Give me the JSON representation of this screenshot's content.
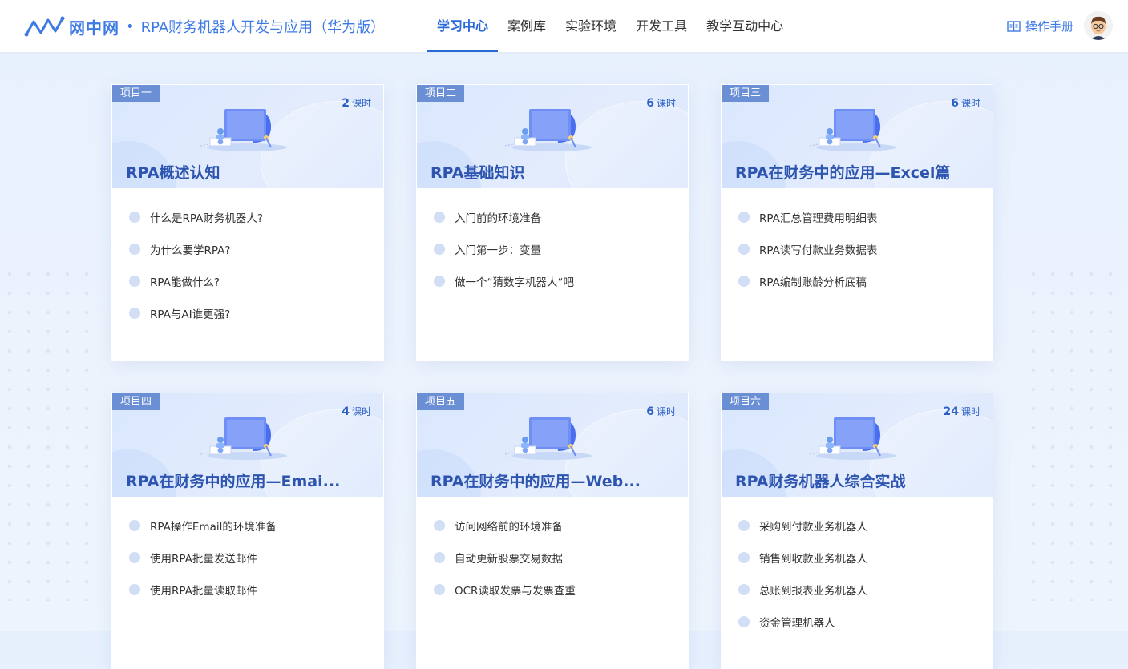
{
  "header": {
    "logo_text": "网中网",
    "separator": "•",
    "course_title": "RPA财务机器人开发与应用（华为版）",
    "nav": [
      {
        "label": "学习中心",
        "active": true
      },
      {
        "label": "案例库",
        "active": false
      },
      {
        "label": "实验环境",
        "active": false
      },
      {
        "label": "开发工具",
        "active": false
      },
      {
        "label": "教学互动中心",
        "active": false
      }
    ],
    "manual_label": "操作手册",
    "manual_icon": "book-icon",
    "avatar_icon": "user-avatar"
  },
  "colors": {
    "accent": "#2a6ad8",
    "brand": "#3d7ae5",
    "tag": "#6a8fd4",
    "title": "#2d55b0"
  },
  "hours_unit": "课时",
  "cards": [
    {
      "tag": "项目一",
      "hours": "2",
      "title": "RPA概述认知",
      "items": [
        "什么是RPA财务机器人?",
        "为什么要学RPA?",
        "RPA能做什么?",
        "RPA与AI谁更强?"
      ]
    },
    {
      "tag": "项目二",
      "hours": "6",
      "title": "RPA基础知识",
      "items": [
        "入门前的环境准备",
        "入门第一步：变量",
        "做一个“猜数字机器人“吧"
      ]
    },
    {
      "tag": "项目三",
      "hours": "6",
      "title": "RPA在财务中的应用—Excel篇",
      "items": [
        "RPA汇总管理费用明细表",
        "RPA读写付款业务数据表",
        "RPA编制账龄分析底稿"
      ]
    },
    {
      "tag": "项目四",
      "hours": "4",
      "title": "RPA在财务中的应用—Emai...",
      "items": [
        "RPA操作Email的环境准备",
        "使用RPA批量发送邮件",
        "使用RPA批量读取邮件"
      ]
    },
    {
      "tag": "项目五",
      "hours": "6",
      "title": "RPA在财务中的应用—Web...",
      "items": [
        "访问网络前的环境准备",
        "自动更新股票交易数据",
        "OCR读取发票与发票查重"
      ]
    },
    {
      "tag": "项目六",
      "hours": "24",
      "title": "RPA财务机器人综合实战",
      "items": [
        "采购到付款业务机器人",
        "销售到收款业务机器人",
        "总账到报表业务机器人",
        "资金管理机器人"
      ]
    }
  ]
}
